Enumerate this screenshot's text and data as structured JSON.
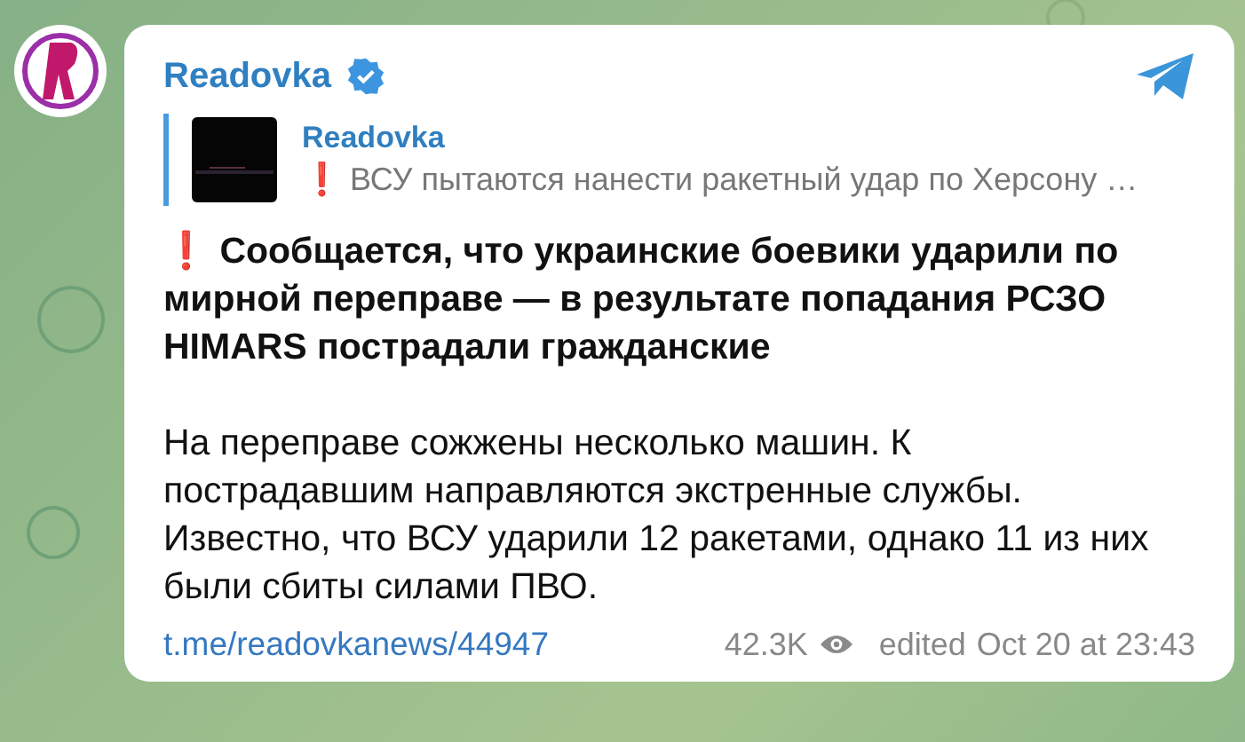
{
  "post": {
    "channel": "Readovka",
    "reply": {
      "title": "Readovka",
      "text": "❗ ВСУ пытаются нанести ракетный удар по Херсону …"
    },
    "paragraphs": [
      {
        "kind": "headline",
        "text": "❗ Сообщается, что украинские боевики ударили по мирной переправе — в результате попадания РСЗО HIMARS пострадали гражданские"
      },
      {
        "kind": "body",
        "text": "На переправе сожжены несколько машин. К пострадавшим направляются экстренные службы. Известно, что ВСУ ударили 12 ракетами, однако 11 из них были сбиты силами ПВО."
      }
    ],
    "link": "t.me/readovkanews/44947",
    "views": "42.3K",
    "edited": "edited",
    "date": "Oct 20 at 23:43"
  }
}
